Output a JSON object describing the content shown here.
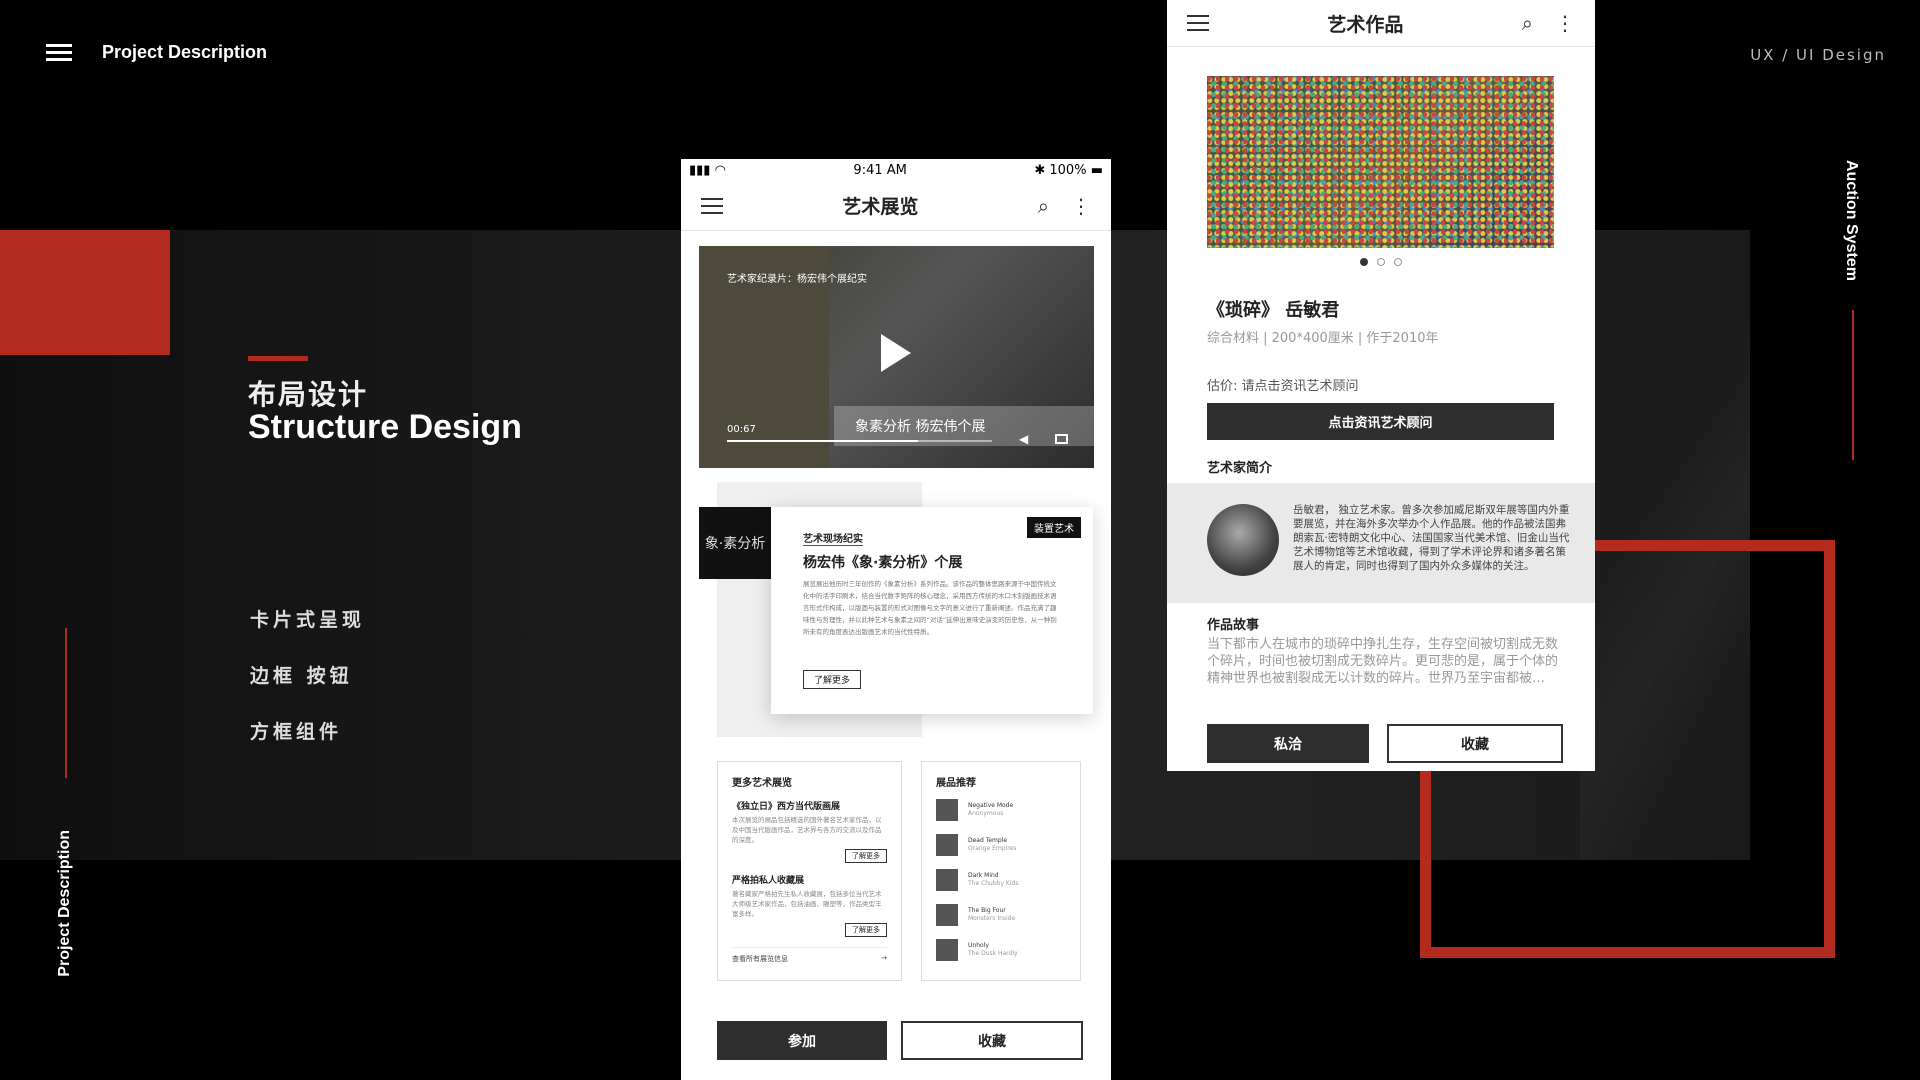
{
  "header": {
    "title": "Project Description",
    "tag": "UX / UI  Design",
    "vertical_right": "Auction System",
    "vertical_left": "Project Description"
  },
  "section": {
    "title_cn": "布局设计",
    "title_en": "Structure Design",
    "features": [
      "卡片式呈现",
      "边框 按钮",
      "方框组件"
    ]
  },
  "colors": {
    "accent": "#b32a1e",
    "dark_button": "#2e2e2e"
  },
  "phone1": {
    "status": {
      "time": "9:41 AM",
      "battery": "100%"
    },
    "title": "艺术展览",
    "video": {
      "caption": "艺术家纪录片：杨宏伟个展纪实",
      "subtitle": "象素分析  杨宏伟个展",
      "time": "00:67",
      "progress": 0.72
    },
    "card": {
      "thumb_text": "象·素分析",
      "badge": "装置艺术",
      "kicker": "艺术现场纪实",
      "title": "杨宏伟《象·素分析》个展",
      "body": "展览展出他历时三年创作的《象素分析》系列作品。该作品的整体思路来源于中国传统文化中的活字印刷术，结合当代数字矩阵的核心理念，采用西方传统的木口木刻版画技术语言形式作构成，以版面与装置的形式对图像与文字的意义进行了重新阐述。作品充满了趣味性与哲理性，并以此种艺术与象素之间的“对话”延伸出意味史演变的历史性，从一种别所未有的角度表达出版画艺术的当代性特质。",
      "more": "了解更多"
    },
    "more_box": {
      "title": "更多艺术展览",
      "items": [
        {
          "title": "《独立日》西方当代版画展",
          "body": "本次展览的展品包括精选的国外著名艺术家作品，以及中国当代版画作品，艺术界与各方的交流以及作品的深度。",
          "button": "了解更多"
        },
        {
          "title": "严格拍私人收藏展",
          "body": "著名藏家严格拍先生私人收藏展，包括多位当代艺术大师级艺术家作品，包括油画、雕塑等，作品类型丰富多样。",
          "button": "了解更多"
        }
      ],
      "all_link": "查看所有展览信息",
      "arrow": "→"
    },
    "products": {
      "title": "展品推荐",
      "items": [
        {
          "name": "Negative Mode",
          "sub": "Anonymous"
        },
        {
          "name": "Dead Temple",
          "sub": "Orange Empires"
        },
        {
          "name": "Dark Mind",
          "sub": "The Chubby Kids"
        },
        {
          "name": "The Big Four",
          "sub": "Monsters Inside"
        },
        {
          "name": "Unholy",
          "sub": "The Dusk Hardly"
        }
      ]
    },
    "buttons": {
      "join": "参加",
      "favorite": "收藏"
    }
  },
  "phone2": {
    "title": "艺术作品",
    "work_title": "《琐碎》  岳敏君",
    "work_meta": "综合材料  |  200*400厘米  |  作于2010年",
    "estimate": "估价: 请点击资讯艺术顾问",
    "consult_button": "点击资讯艺术顾问",
    "artist_heading": "艺术家简介",
    "artist_bio": "岳敏君，  独立艺术家。曾多次参加威尼斯双年展等国内外重要展览，并在海外多次举办个人作品展。他的作品被法国弗朗索瓦·密特朗文化中心、法国国家当代美术馆、旧金山当代艺术博物馆等艺术馆收藏，得到了学术评论界和诸多著名策展人的肯定，同时也得到了国内外众多媒体的关注。",
    "story_heading": "作品故事",
    "story": "当下都市人在城市的琐碎中挣扎生存，生存空间被切割成无数个碎片，时间也被切割成无数碎片。更可悲的是，属于个体的精神世界也被割裂成无以计数的碎片。世界乃至宇宙都被…",
    "buttons": {
      "message": "私洽",
      "favorite": "收藏"
    }
  }
}
